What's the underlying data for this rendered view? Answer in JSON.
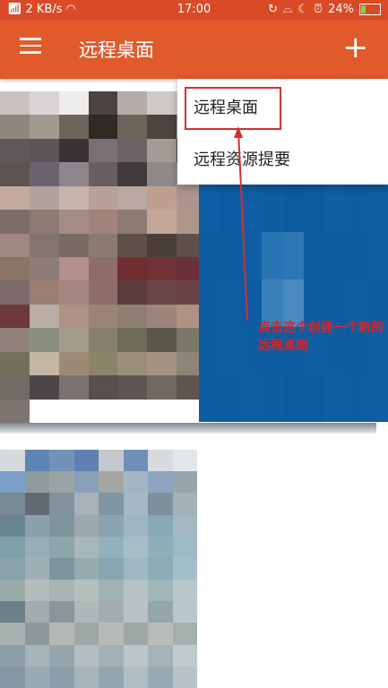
{
  "status_bar": {
    "speed": "2 KB/s",
    "time": "17:00",
    "battery_percent": "24%",
    "battery_level": 0.24,
    "icons": [
      "signal-icon",
      "wifi-icon",
      "sync-icon",
      "headset-icon",
      "moon-icon",
      "alarm-icon",
      "battery-icon"
    ]
  },
  "appbar": {
    "title": "远程桌面",
    "menu_icon": "hamburger-menu-icon",
    "add_icon": "plus-icon",
    "background": "#e05a2c"
  },
  "dropdown": {
    "items": [
      {
        "label": "远程桌面"
      },
      {
        "label": "远程资源提要"
      }
    ]
  },
  "annotation": {
    "text": "点击这个创建一个新的远程桌面",
    "color": "#e02020"
  },
  "tiles": [
    {
      "name": "desktop-tile-1",
      "colors": [
        "#c9c2c1",
        "#d8d4d3",
        "#efedec",
        "#4b4341",
        "#b3aca6",
        "#cfc9c6",
        "#e1dfdc",
        "#8f8680",
        "#a09a91",
        "#6d6559",
        "#2e2a24",
        "#6c6359",
        "#4d4540",
        "#b5aeaa",
        "#5f5a59",
        "#5b5558",
        "#3a3335",
        "#7a7074",
        "#6b6264",
        "#a49b97",
        "#545050",
        "#5e5451",
        "#6b6370",
        "#8e868d",
        "#695f61",
        "#413b3b",
        "#8f8a89",
        "#b59f96",
        "#c4a99e",
        "#b0a29c",
        "#c8b4ab",
        "#b7a19a",
        "#bba7a1",
        "#c19f90",
        "#ab9590",
        "#7b6d68",
        "#8c7a73",
        "#a48c85",
        "#a0847b",
        "#8d7a72",
        "#c2a79a",
        "#ad978a",
        "#9f8982",
        "#827470",
        "#7a6a64",
        "#8b7a70",
        "#5e5048",
        "#4a3f38",
        "#5f5049",
        "#8a7367",
        "#8e7c79",
        "#b38f8d",
        "#8f6d6d",
        "#702e33",
        "#6e3235",
        "#6a3139",
        "#7d6b6c",
        "#9b7f76",
        "#a48680",
        "#8f6d6b",
        "#5a3b3d",
        "#6a4647",
        "#6a4444",
        "#6c3a3d",
        "#b8ada5",
        "#ad9385",
        "#9a8378",
        "#8f7e72",
        "#9b8479",
        "#af9284",
        "#8f8079",
        "#8a8f7d",
        "#a39c8c",
        "#86826f",
        "#6f6c5b",
        "#5a5749",
        "#7c7869",
        "#71705f",
        "#c3b6a3",
        "#9c8a76",
        "#8c8468",
        "#9a8f7a",
        "#a49383",
        "#8d8577",
        "#6f6c65",
        "#4c4649",
        "#7d7270",
        "#5a4f4f",
        "#5f5653",
        "#716864",
        "#5f5650",
        "#807471"
      ]
    },
    {
      "name": "desktop-tile-2",
      "colors": [
        "#0e5ea5",
        "#0d5ca3",
        "#0f5ea4",
        "#0e5ca2",
        "#0c5aa0",
        "#0d5ba1",
        "#105ea4",
        "#0e5ca2",
        "#0f5da3",
        "#0e5ca2",
        "#0d5ba1",
        "#0f5da3",
        "#2874b2",
        "#2d78b4",
        "#0d5ba1",
        "#0e5ca2",
        "#0c5aa0",
        "#0f5da3",
        "#0e5ca2",
        "#0f5da3",
        "#0d5ba1",
        "#3a80ba",
        "#4a8ac0",
        "#0e5ca2",
        "#0d5ba1",
        "#0f5da3",
        "#0e5ca2",
        "#0e5ca2",
        "#0f5da3",
        "#0e5ca2",
        "#0d5ba1",
        "#0e5ca2",
        "#0f5da3",
        "#0e5ca2",
        "#0d5ba1",
        "#0f5da3",
        "#0e5ca2",
        "#0d5ba1",
        "#0f5da3",
        "#0e5ca2",
        "#0c5aa0",
        "#0d5ba1",
        "#105ea4",
        "#0e5ca2",
        "#0f5da3"
      ]
    },
    {
      "name": "desktop-tile-3",
      "colors": [
        "#d5d9dc",
        "#5d85b4",
        "#7492b8",
        "#5f80b2",
        "#c3c8cc",
        "#6f8fb9",
        "#d6dbde",
        "#e2e6e8",
        "#7ca0c8",
        "#8f9a9c",
        "#9ba3a4",
        "#8aa0b9",
        "#a4a6a3",
        "#a4b6c6",
        "#8ea4c0",
        "#98a5ad",
        "#7a8a92",
        "#606a70",
        "#82929a",
        "#a6b2b8",
        "#8196a4",
        "#a7b7c3",
        "#7d919d",
        "#a4b2b8",
        "#6a8592",
        "#8ba0a8",
        "#7f959c",
        "#9aaab0",
        "#89a3b0",
        "#9fb6c2",
        "#88a8b7",
        "#a3b8c2",
        "#7f9fa9",
        "#96aeb4",
        "#8ca6aa",
        "#a7b8bb",
        "#94b0ba",
        "#a6bec6",
        "#8fafbb",
        "#9ebbc5",
        "#8aa3ab",
        "#9eb0b4",
        "#7c949c",
        "#96abb0",
        "#88a5b1",
        "#9fb7c0",
        "#8eacb8",
        "#a3bec8",
        "#9cacad",
        "#b3bdbc",
        "#a7b4b1",
        "#b4bfbc",
        "#a0b3b4",
        "#b5c3c4",
        "#9fb5b8",
        "#b6c6c9",
        "#6d8088",
        "#a2abae",
        "#8b969a",
        "#b0b7b9",
        "#a2adb0",
        "#bac2c4",
        "#95a6ad",
        "#b9c6ca",
        "#a9b0b0",
        "#8d9998",
        "#b3b8b6",
        "#a0a8a6",
        "#b7bbb8",
        "#9ea8a6",
        "#b8bdb9",
        "#a5afac",
        "#8e9ea6",
        "#a6b3b7",
        "#97a6ad",
        "#b4bec1",
        "#a2b1b7",
        "#bcc6c9",
        "#a4b3b9",
        "#c0cacd",
        "#8396a2",
        "#9aabb4",
        "#8ba0ab",
        "#a6b5bc",
        "#93a5ae",
        "#b1bec4",
        "#98aab3",
        "#b8c4ca"
      ]
    }
  ]
}
